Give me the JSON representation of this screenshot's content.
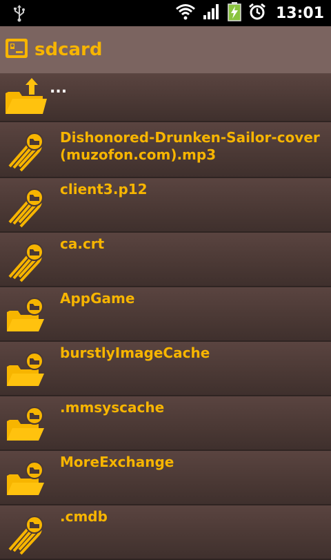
{
  "status_bar": {
    "time": "13:01",
    "icons": [
      "usb-icon",
      "wifi-icon",
      "signal-icon",
      "battery-charging-icon",
      "alarm-icon"
    ]
  },
  "title_bar": {
    "title": "sdcard",
    "icon": "sdcard-icon"
  },
  "files": [
    {
      "name": "...",
      "type": "parent"
    },
    {
      "name": "Dishonored-Drunken-Sailor-cover(muzofon.com).mp3",
      "type": "file"
    },
    {
      "name": "client3.p12",
      "type": "file"
    },
    {
      "name": "ca.crt",
      "type": "file"
    },
    {
      "name": "AppGame",
      "type": "folder"
    },
    {
      "name": "burstlyImageCache",
      "type": "folder"
    },
    {
      "name": ".mmsyscache",
      "type": "folder"
    },
    {
      "name": "MoreExchange",
      "type": "folder"
    },
    {
      "name": ".cmdb",
      "type": "file"
    }
  ],
  "colors": {
    "accent": "#f7b500",
    "title_bar_bg": "#7b6460",
    "list_bg": "#4a3834"
  }
}
